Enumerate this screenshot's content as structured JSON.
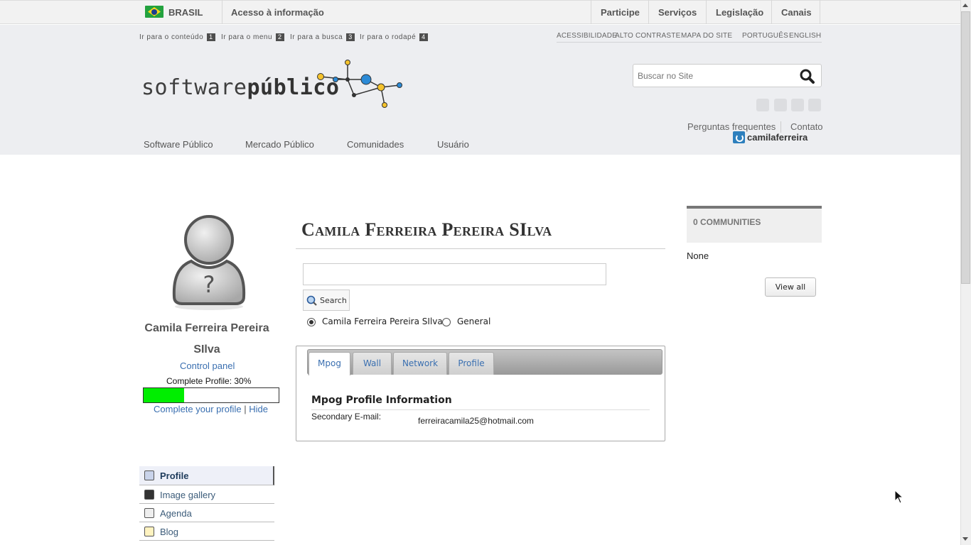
{
  "govbar": {
    "country": "BRASIL",
    "access_info": "Acesso à informação",
    "links": [
      "Participe",
      "Serviços",
      "Legislação",
      "Canais"
    ]
  },
  "accessibility": {
    "skip_links": [
      {
        "label": "Ir para o conteúdo",
        "key": "1"
      },
      {
        "label": "Ir para o menu",
        "key": "2"
      },
      {
        "label": "Ir para a busca",
        "key": "3"
      },
      {
        "label": "Ir para o rodapé",
        "key": "4"
      }
    ],
    "top_links": [
      "ACESSIBILIDADE",
      "ALTO CONTRASTE",
      "MAPA DO SITE",
      "PORTUGUÊS",
      "ENGLISH"
    ]
  },
  "logo": {
    "part1": "software",
    "part2": "público"
  },
  "search": {
    "placeholder": "Buscar no Site"
  },
  "social_icons": [
    "twitter-icon",
    "youtube-icon",
    "facebook-icon",
    "flickr-icon"
  ],
  "header_links": {
    "faq": "Perguntas frequentes",
    "contact": "Contato"
  },
  "user": {
    "name": "camilaferreira"
  },
  "nav": [
    "Software Público",
    "Mercado Público",
    "Comunidades",
    "Usuário"
  ],
  "profile": {
    "name_line1": "Camila Ferreira Pereira",
    "name_line2": "SIlva",
    "control_panel": "Control panel",
    "complete_label": "Complete Profile: 30%",
    "complete_fraction": 0.3,
    "complete_link": "Complete your profile",
    "separator": "|",
    "hide": "Hide"
  },
  "side_menu": [
    {
      "label": "Profile",
      "icon": "profile-icon",
      "active": true
    },
    {
      "label": "Image gallery",
      "icon": "image-gallery-icon",
      "active": false
    },
    {
      "label": "Agenda",
      "icon": "calendar-icon",
      "active": false
    },
    {
      "label": "Blog",
      "icon": "blog-icon",
      "active": false
    }
  ],
  "main": {
    "title": "Camila Ferreira Pereira SIlva",
    "search_button": "Search",
    "radio": [
      {
        "label": "Camila Ferreira Pereira SIlva",
        "checked": true
      },
      {
        "label": "General",
        "checked": false
      }
    ],
    "tabs": [
      "Mpog",
      "Wall",
      "Network",
      "Profile"
    ],
    "active_tab": "Mpog",
    "info_title": "Mpog Profile Information",
    "info_key": "Secondary E-mail:",
    "info_value": "ferreiracamila25@hotmail.com"
  },
  "communities": {
    "header": "0 COMMUNITIES",
    "empty": "None",
    "view_all": "View all"
  },
  "colors": {
    "progress": "#00ee00",
    "link": "#3a6fb0",
    "brand_blue": "#2d7fbd"
  }
}
